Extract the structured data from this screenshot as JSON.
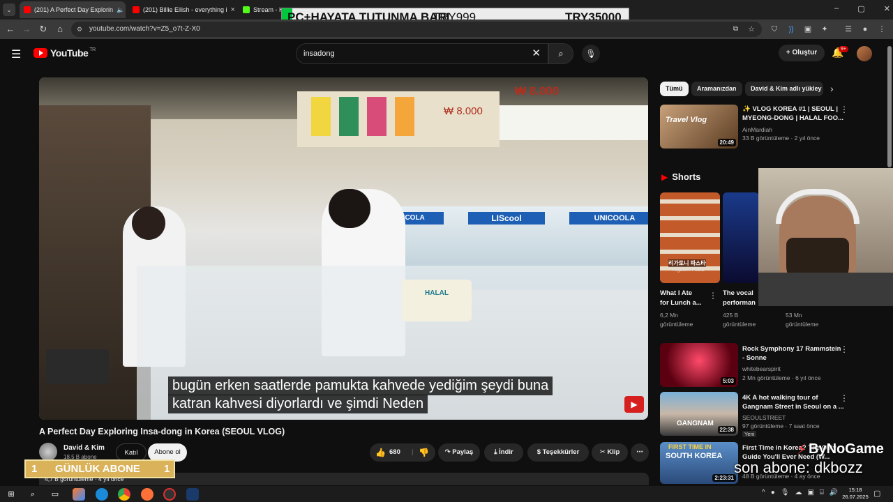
{
  "browser": {
    "tabs": [
      {
        "title": "(201) A Perfect Day Explorin",
        "active": true
      },
      {
        "title": "(201) Billie Eilish - everything i",
        "active": false
      },
      {
        "title": "Stream - K",
        "active": false
      }
    ],
    "url": "youtube.com/watch?v=Z5_o7t-Z-X0"
  },
  "stream_overlay": {
    "bar_text": "PC+HAYATA TUTUNMA BARI",
    "amount_current": "TRY999",
    "amount_goal": "TRY35000",
    "progress_fraction": 0.03,
    "daily_sub_label": "GÜNLÜK ABONE",
    "daily_sub_left": "1",
    "daily_sub_right": "1",
    "brand_text": "ByNoGame",
    "last_sub_text": "son abone: dkbozz"
  },
  "youtube": {
    "logo_text": "YouTube",
    "logo_country": "TR",
    "search_query": "insadong",
    "create_label": "Oluştur",
    "notif_count": "9+",
    "video": {
      "subtitle_line1": "bugün erken saatlerde pamukta kahvede yediğim şeydi buna",
      "subtitle_line2": "katran kahvesi diyorlardı ve şimdi  Neden",
      "title": "A Perfect Day Exploring Insa-dong in Korea (SEOUL VLOG)",
      "channel": "David & Kim",
      "subs": "18,5 B abone",
      "join_label": "Katıl",
      "subscribe_label": "Abone ol",
      "likes": "680",
      "share_label": "Paylaş",
      "download_label": "İndir",
      "thanks_label": "Teşekkürler",
      "clip_label": "Klip",
      "views_partial": "4,7 B görüntüleme · 4 yıl önce"
    },
    "chips": [
      "Tümü",
      "Aramanızdan",
      "David & Kim adlı yükley"
    ],
    "related": [
      {
        "title1": "✨ VLOG KOREA #1 | SEOUL |",
        "title2": "MYEONG-DONG | HALAL FOO...",
        "channel": "AinMardiah",
        "meta": "33 B görüntüleme · 2 yıl önce",
        "duration": "20:49",
        "badge": ""
      },
      {
        "title1": "Rock Symphony 17 Rammstein",
        "title2": "- Sonne",
        "channel": "whitebearspirit",
        "meta": "2 Mn görüntüleme · 6 yıl önce",
        "duration": "5:03",
        "badge": ""
      },
      {
        "title1": "4K A hot walking tour of",
        "title2": "Gangnam Street in Seoul on a ...",
        "channel": "SEOULSTREET",
        "meta": "97 görüntüleme · 7 saat önce",
        "duration": "22:38",
        "badge": "Yeni"
      },
      {
        "title1": "First Time in Korea? The Only",
        "title2": "Guide You'll Ever Need (W...",
        "channel": "",
        "meta": "48 B görüntüleme · 4 ay önce",
        "duration": "2:23:31",
        "badge": ""
      }
    ],
    "shorts_label": "Shorts",
    "shorts": [
      {
        "title1": "What I Ate",
        "title2": "for Lunch a...",
        "views1": "6,2 Mn",
        "views2": "görüntüleme"
      },
      {
        "title1": "The vocal",
        "title2": "performan",
        "views1": "425 B",
        "views2": "görüntüleme"
      },
      {
        "title1": "",
        "title2": "",
        "views1": "53 Mn",
        "views2": "görüntüleme"
      }
    ],
    "thumb_texts": {
      "vlog": "Travel Vlog",
      "gangnam": "GANGNAM",
      "southkorea": "SOUTH KOREA",
      "firsttime": "FIRST TIME IN",
      "pasta": "리가토니 파스타",
      "pasta_en": "Rigatoni Pasta"
    }
  },
  "video_scene": {
    "sign_price": "₩ 8.000",
    "price_left": "₩ 8.000",
    "brand1": "LIScool",
    "brand2": "UNICOOLA",
    "brand3": "UNICOLA",
    "halal": "HALAL"
  },
  "taskbar": {
    "time": "15:18",
    "date": "26.07.2025"
  },
  "colors": {
    "yt_red": "#ff0000",
    "overlay_green": "#00c83c",
    "overlay_gold": "#d9b25a"
  }
}
